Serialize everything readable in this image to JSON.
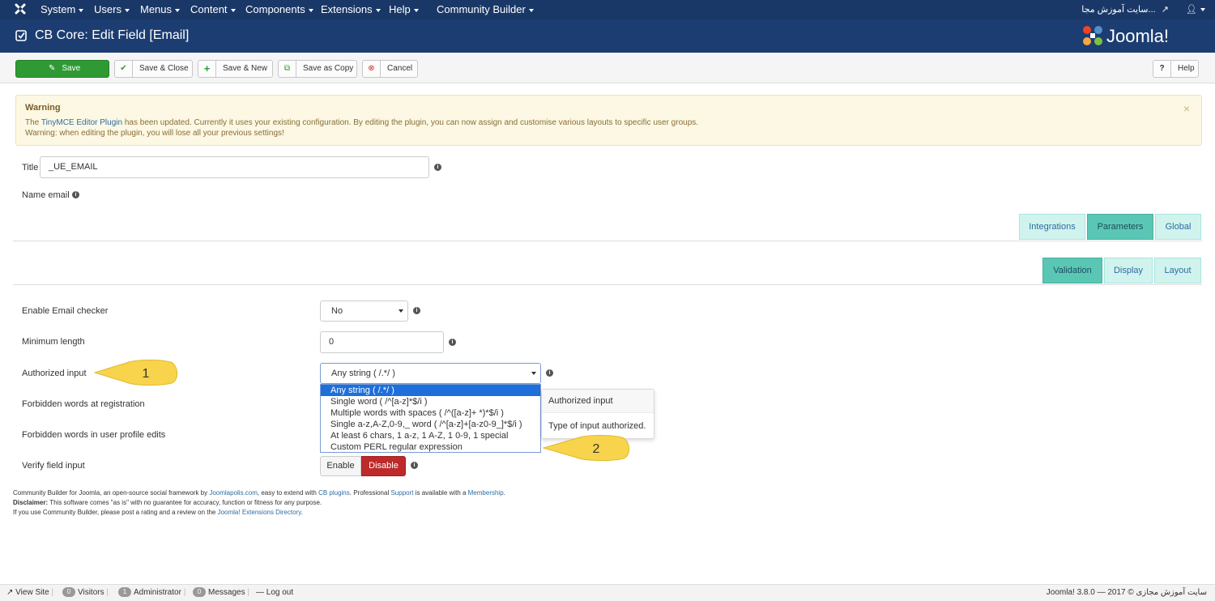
{
  "topbar": {
    "menus": [
      {
        "label": "System"
      },
      {
        "label": "Users"
      },
      {
        "label": "Menus"
      },
      {
        "label": "Content"
      },
      {
        "label": "Components"
      },
      {
        "label": "Extensions"
      },
      {
        "label": "Help"
      },
      {
        "label": "Community Builder"
      }
    ],
    "site_link": "سایت آموزش مجا..."
  },
  "header": {
    "title": "CB Core: Edit Field [Email]",
    "logo_text": "Joomla!"
  },
  "toolbar": {
    "save": "Save",
    "save_close": "Save & Close",
    "save_new": "Save & New",
    "save_copy": "Save as Copy",
    "cancel": "Cancel",
    "help": "Help"
  },
  "alert": {
    "heading": "Warning",
    "line1_pre": "The ",
    "line1_link": "TinyMCE Editor Plugin",
    "line1_post": " has been updated. Currently it uses your existing configuration. By editing the plugin, you can now assign and customise various layouts to specific user groups.",
    "line2": "Warning: when editing the plugin, you will lose all your previous settings!",
    "close": "×"
  },
  "form": {
    "title_label": "Title",
    "title_value": "_UE_EMAIL",
    "name_label": "Name email"
  },
  "tabs_main": [
    {
      "label": "Integrations"
    },
    {
      "label": "Parameters"
    },
    {
      "label": "Global"
    }
  ],
  "tabs_sub": [
    {
      "label": "Validation"
    },
    {
      "label": "Display"
    },
    {
      "label": "Layout"
    }
  ],
  "fields": {
    "email_checker_label": "Enable Email checker",
    "email_checker_value": "No",
    "min_length_label": "Minimum length",
    "min_length_value": "0",
    "authorized_input_label": "Authorized input",
    "authorized_input_value": "Any string ( /.*/ )",
    "forbidden_reg_label": "Forbidden words at registration",
    "forbidden_profile_label": "Forbidden words in user profile edits",
    "verify_label": "Verify field input",
    "verify_enable": "Enable",
    "verify_disable": "Disable"
  },
  "dropdown_options": [
    "Any string ( /.*/ )",
    "Single word ( /^[a-z]*$/i )",
    "Multiple words with spaces ( /^([a-z]+ *)*$/i )",
    "Single a-z,A-Z,0-9,_ word ( /^[a-z]+[a-z0-9_]*$/i )",
    "At least 6 chars, 1 a-z, 1 A-Z, 1 0-9, 1 special",
    "Custom PERL regular expression"
  ],
  "tooltip": {
    "heading": "Authorized input",
    "body": "Type of input authorized."
  },
  "callouts": {
    "one": "1",
    "two": "2"
  },
  "footer": {
    "l1_a": "Community Builder for Joomla, an open-source social framework by ",
    "l1_link1": "Joomlapolis.com",
    "l1_b": ", easy to extend with ",
    "l1_link2": "CB plugins",
    "l1_c": ". Professional ",
    "l1_link3": "Support",
    "l1_d": " is available with a ",
    "l1_link4": "Membership",
    "l1_e": ".",
    "l2_bold": "Disclaimer:",
    "l2_rest": " This software comes \"as is\" with no guarantee for accuracy, function or fitness for any purpose.",
    "l3_a": "If you use Community Builder, please post a rating and a review on the ",
    "l3_link": "Joomla! Extensions Directory",
    "l3_b": "."
  },
  "statusbar": {
    "view_site": "View Site",
    "visitors_count": "0",
    "visitors": "Visitors",
    "admin_count": "1",
    "admin": "Administrator",
    "messages_count": "0",
    "messages": "Messages",
    "logout": "Log out",
    "right": "Joomla! 3.8.0 — سایت آموزش مجازی © 2017"
  },
  "colors": {
    "topbar": "#1a3867",
    "header": "#1c3d71",
    "save": "#2f9a34",
    "tab_active": "#5ac7b5",
    "tab_inactive": "#d1f3ee",
    "disable": "#bd2a2a",
    "callout": "#f7d44c"
  }
}
